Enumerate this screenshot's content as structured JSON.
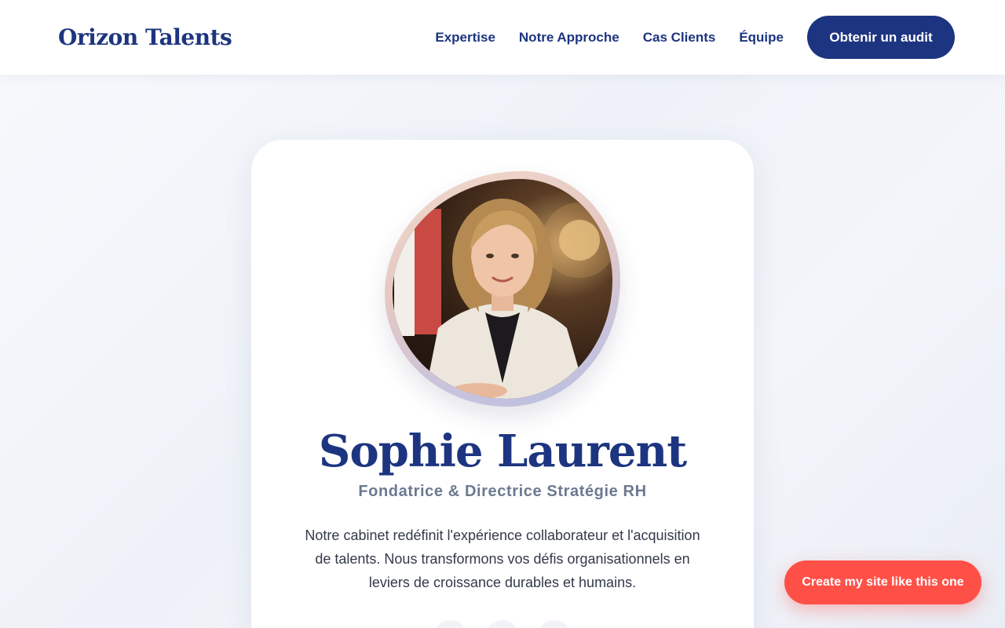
{
  "header": {
    "logo": "Orizon Talents",
    "nav": [
      {
        "label": "Expertise"
      },
      {
        "label": "Notre Approche"
      },
      {
        "label": "Cas Clients"
      },
      {
        "label": "Équipe"
      }
    ],
    "cta_label": "Obtenir un audit"
  },
  "profile": {
    "portrait_icon": "portrait-photo",
    "name": "Sophie Laurent",
    "title": "Fondatrice & Directrice Stratégie RH",
    "bio": "Notre cabinet redéfinit l'expérience collaborateur et l'acquisition de talents. Nous transformons vos défis organisationnels en leviers de croissance durables et humains."
  },
  "floating_button": {
    "label": "Create my site like this one"
  },
  "colors": {
    "brand": "#1d3580",
    "accent": "#ff5048",
    "muted": "#6b7991"
  }
}
